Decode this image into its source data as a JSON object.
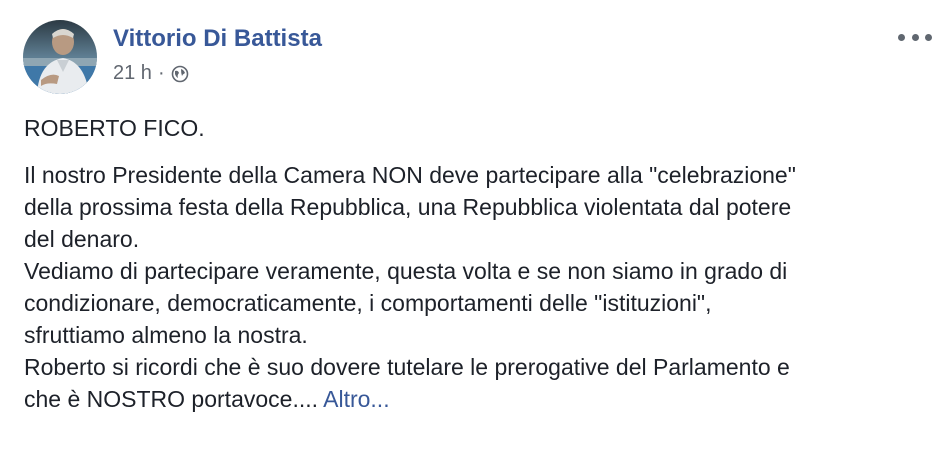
{
  "post": {
    "author": "Vittorio Di Battista",
    "time": "21 h",
    "separator": "·",
    "privacy_icon": "globe-icon",
    "menu_icon": "more-options-icon",
    "heading": "ROBERTO FICO.",
    "lines": [
      "Il nostro Presidente della Camera NON deve partecipare alla \"celebrazione\"",
      "della prossima festa della Repubblica, una Repubblica violentata dal potere",
      "del denaro.",
      "Vediamo di partecipare veramente, questa volta e se non siamo in grado di",
      "condizionare, democraticamente, i comportamenti delle \"istituzioni\",",
      "sfruttiamo almeno la nostra.",
      "Roberto si ricordi che è suo dovere tutelare le prerogative del Parlamento e",
      "che è NOSTRO portavoce.... "
    ],
    "more_link": "Altro...",
    "colors": {
      "link": "#385898",
      "text": "#1d2129",
      "meta": "#616770"
    }
  }
}
